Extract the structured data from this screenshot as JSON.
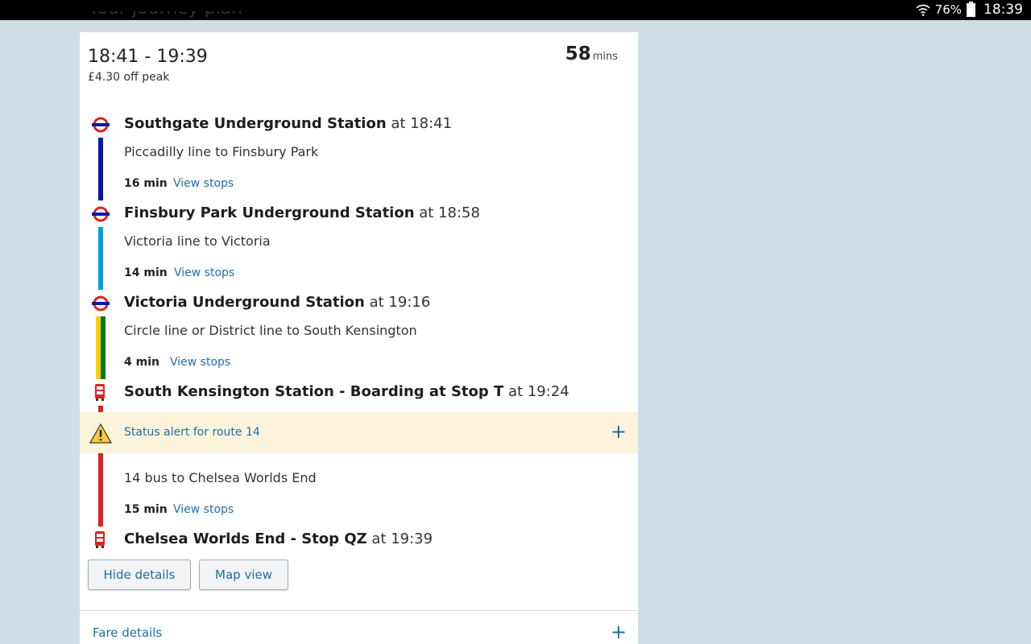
{
  "status_bar": {
    "battery": "76%",
    "time": "18:39"
  },
  "header_peek": "Your journey plan",
  "journey": {
    "time_range": "18:41 - 19:39",
    "fare": "£4.30 off peak",
    "duration_value": "58",
    "duration_unit": "mins"
  },
  "stops": [
    {
      "name": "Southgate Underground Station",
      "at": "at 18:41",
      "mode": "tube-roundel-icon"
    },
    {
      "name": "Finsbury Park Underground Station",
      "at": "at 18:58",
      "mode": "tube-roundel-icon"
    },
    {
      "name": "Victoria Underground Station",
      "at": "at 19:16",
      "mode": "tube-roundel-icon"
    },
    {
      "name": "South Kensington Station - Boarding at Stop T",
      "at": "at 19:24",
      "mode": "bus-icon"
    },
    {
      "name": "Chelsea Worlds End - Stop QZ",
      "at": "at 19:39",
      "mode": "bus-icon"
    }
  ],
  "legs": [
    {
      "description": "Piccadilly line to Finsbury Park",
      "duration": "16 min",
      "view_label": "View stops",
      "colors": [
        "#0019a8"
      ]
    },
    {
      "description": "Victoria line to Victoria",
      "duration": "14 min",
      "view_label": "View stops",
      "colors": [
        "#00a0e2"
      ]
    },
    {
      "description": "Circle line or District line to South Kensington",
      "duration": "4 min",
      "view_label": "View stops",
      "colors": [
        "#ffce00",
        "#00782a"
      ]
    },
    {
      "description": "14 bus to Chelsea Worlds End",
      "duration": "15 min",
      "view_label": "View stops",
      "colors": [
        "#dc241f"
      ]
    }
  ],
  "alert": {
    "text": "Status alert for route 14",
    "expand": "+"
  },
  "buttons": {
    "hide_details": "Hide details",
    "map_view": "Map view"
  },
  "fare_details": {
    "label": "Fare details",
    "expand": "+"
  },
  "colors": {
    "link": "#1f6fa8",
    "alert_bg": "#fbf3dc",
    "background": "#cfdee7"
  }
}
